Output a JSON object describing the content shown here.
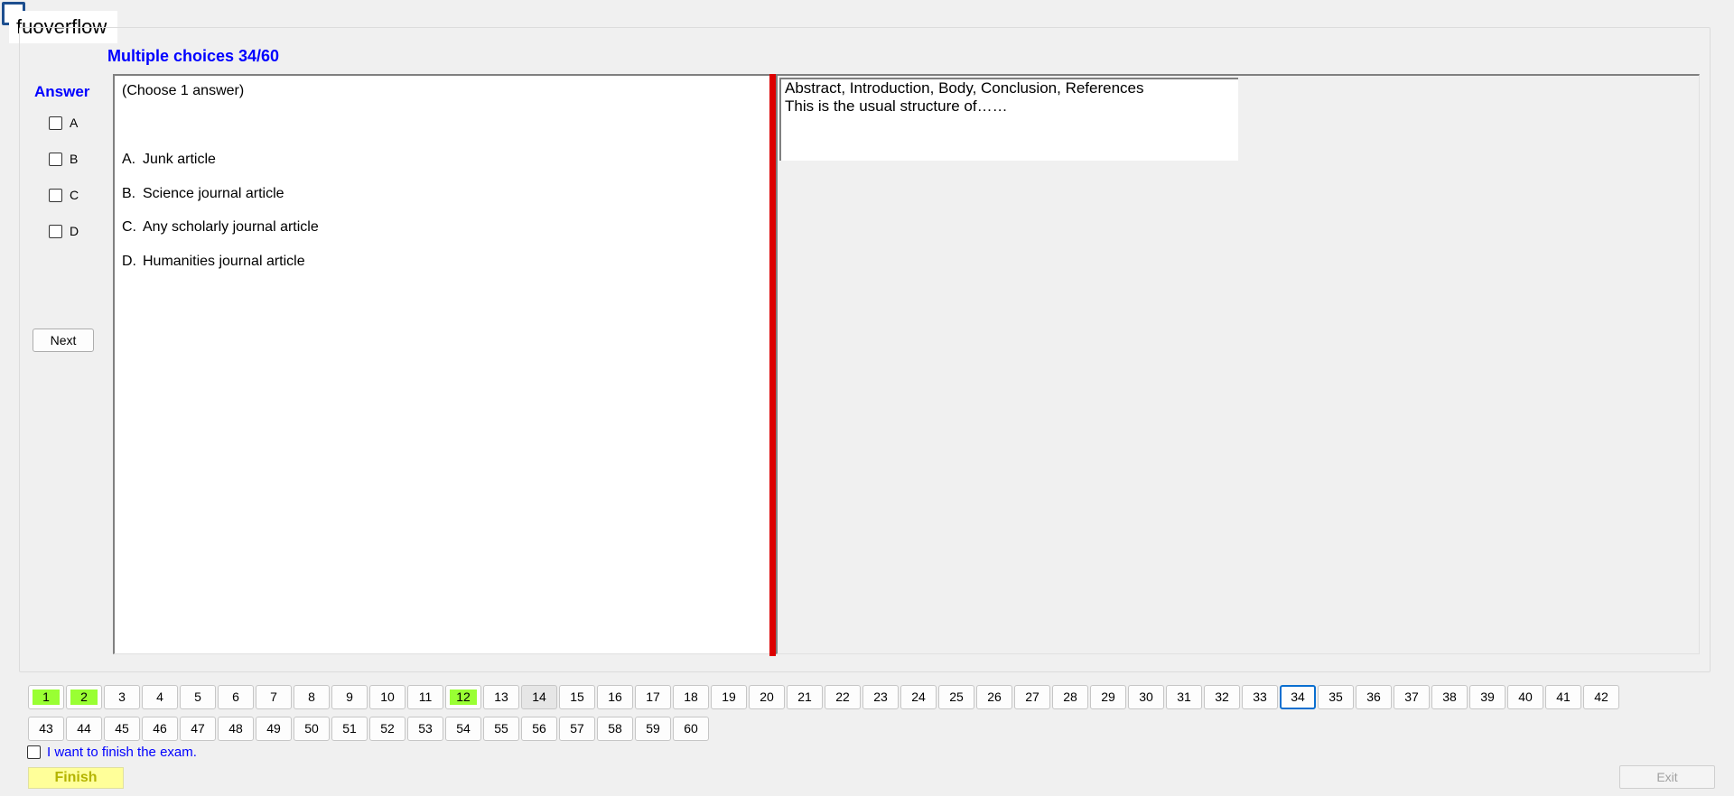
{
  "window": {
    "title": "fuoverflow"
  },
  "header": {
    "title": "Multiple choices 34/60"
  },
  "answer": {
    "label": "Answer",
    "options": [
      "A",
      "B",
      "C",
      "D"
    ],
    "next_label": "Next"
  },
  "question": {
    "hint": "(Choose 1 answer)",
    "choices": [
      {
        "letter": "A.",
        "text": "Junk article"
      },
      {
        "letter": "B.",
        "text": "Science journal article"
      },
      {
        "letter": "C.",
        "text": "Any scholarly journal article"
      },
      {
        "letter": "D.",
        "text": "Humanities journal article"
      }
    ],
    "text_line1": "Abstract, Introduction, Body, Conclusion, References",
    "text_line2": "This is the usual structure of……"
  },
  "navigation": {
    "row1": [
      "1",
      "2",
      "3",
      "4",
      "5",
      "6",
      "7",
      "8",
      "9",
      "10",
      "11",
      "12",
      "13",
      "14",
      "15",
      "16",
      "17",
      "18",
      "19",
      "20",
      "21",
      "22",
      "23",
      "24",
      "25",
      "26",
      "27",
      "28",
      "29",
      "30",
      "31",
      "32",
      "33",
      "34",
      "35",
      "36",
      "37",
      "38",
      "39",
      "40",
      "41",
      "42"
    ],
    "row2": [
      "43",
      "44",
      "45",
      "46",
      "47",
      "48",
      "49",
      "50",
      "51",
      "52",
      "53",
      "54",
      "55",
      "56",
      "57",
      "58",
      "59",
      "60"
    ],
    "answered": [
      "1",
      "2",
      "12"
    ],
    "visited": [
      "14"
    ],
    "current": "34",
    "answered_color": "#99ff33",
    "current_border_color": "#0a6fd0"
  },
  "footer": {
    "finish_checkbox_label": "I want to finish the exam.",
    "finish_label": "Finish",
    "exit_label": "Exit"
  }
}
